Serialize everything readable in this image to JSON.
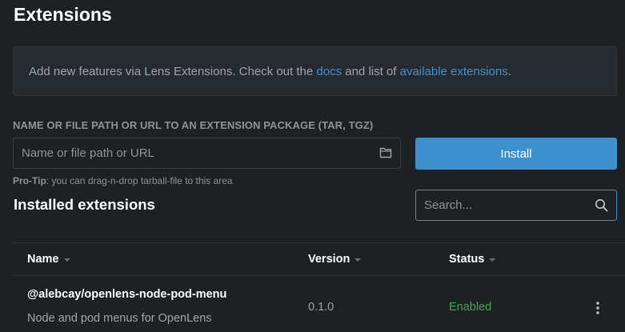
{
  "header": {
    "title": "Extensions"
  },
  "info": {
    "text_before_docs": "Add new features via Lens Extensions. Check out the ",
    "docs_link": "docs",
    "text_between": " and list of ",
    "available_link": "available extensions",
    "text_after": "."
  },
  "install": {
    "label": "NAME OR FILE PATH OR URL TO AN EXTENSION PACKAGE (TAR, TGZ)",
    "placeholder": "Name or file path or URL",
    "value": "",
    "button_label": "Install",
    "folder_icon": "folder-icon",
    "pro_tip_label": "Pro-Tip",
    "pro_tip_text": ": you can drag-n-drop tarball-file to this area"
  },
  "installed": {
    "title": "Installed extensions",
    "search_placeholder": "Search...",
    "search_value": "",
    "search_icon": "search-icon",
    "columns": [
      "Name",
      "Version",
      "Status"
    ],
    "rows": [
      {
        "name": "@alebcay/openlens-node-pod-menu",
        "description": "Node and pod menus for OpenLens",
        "version": "0.1.0",
        "status": "Enabled"
      }
    ]
  },
  "colors": {
    "background": "#1e2124",
    "accent": "#3d90ce",
    "status_enabled": "#48a25b"
  }
}
